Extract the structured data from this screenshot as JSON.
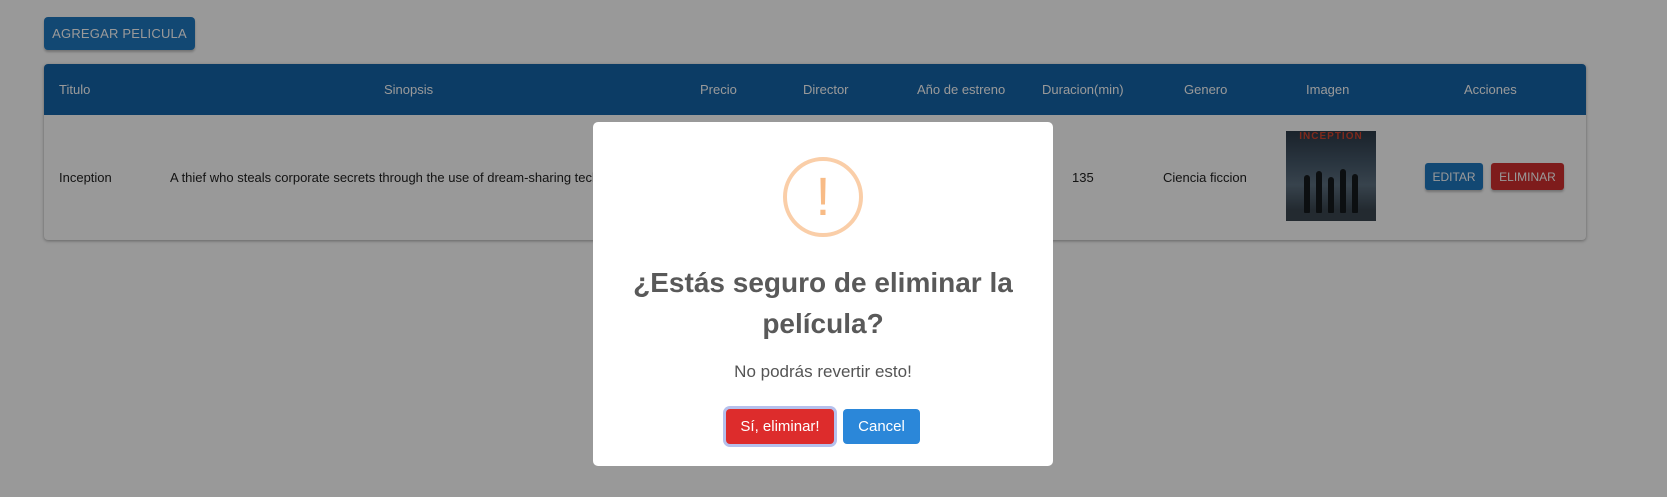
{
  "toolbar": {
    "add_movie_label": "AGREGAR PELICULA"
  },
  "table": {
    "columns": [
      "Titulo",
      "Sinopsis",
      "Precio",
      "Director",
      "Año de estreno",
      "Duracion(min)",
      "Genero",
      "Imagen",
      "Acciones"
    ],
    "rows": [
      {
        "titulo": "Inception",
        "sinopsis": "A thief who steals corporate secrets through the use of dream-sharing tech",
        "duracion": "135",
        "genero": "Ciencia ficcion",
        "poster_title": "INCEPTION",
        "actions": {
          "edit_label": "EDITAR",
          "delete_label": "ELIMINAR"
        }
      }
    ]
  },
  "dialog": {
    "icon": "exclamation-icon",
    "icon_glyph": "!",
    "title": "¿Estás seguro de eliminar la película?",
    "text": "No podrás revertir esto!",
    "confirm_label": "Sí, eliminar!",
    "cancel_label": "Cancel"
  },
  "colors": {
    "primary": "#1f78c0",
    "header": "#1565a9",
    "danger": "#d32f2f",
    "warning_icon": "#f8bb86"
  }
}
